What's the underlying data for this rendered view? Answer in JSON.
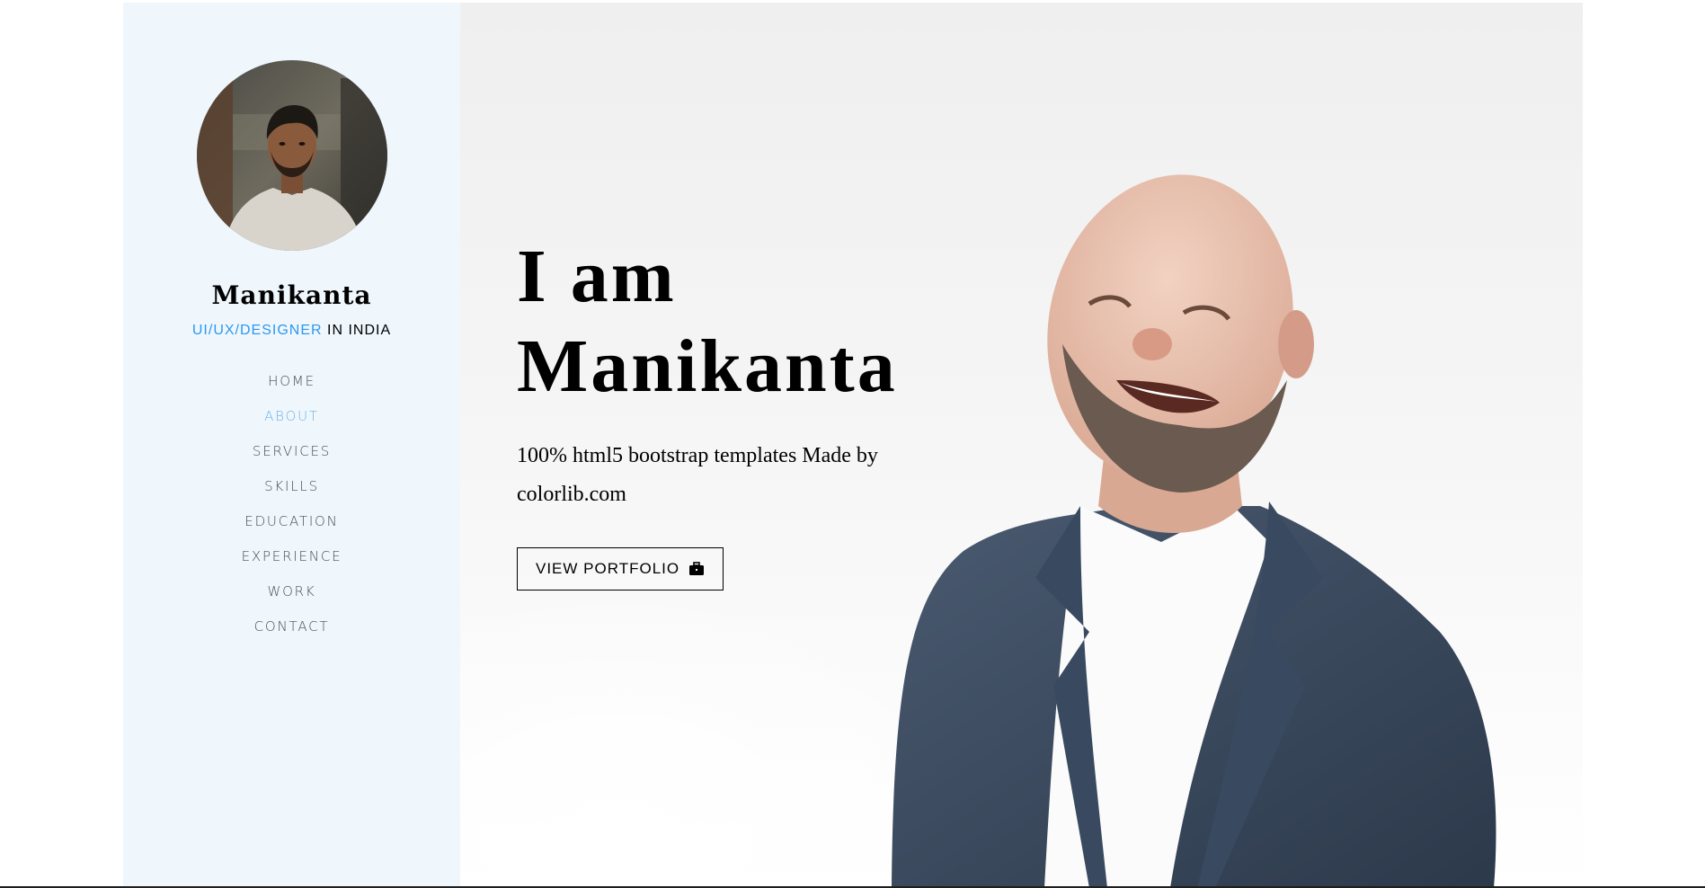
{
  "profile": {
    "name": "Manikanta",
    "role_accent": "UI/UX/DESIGNER",
    "role_rest": " IN INDIA"
  },
  "nav": {
    "items": [
      {
        "label": "HOME"
      },
      {
        "label": "ABOUT"
      },
      {
        "label": "SERVICES"
      },
      {
        "label": "SKILLS"
      },
      {
        "label": "EDUCATION"
      },
      {
        "label": "EXPERIENCE"
      },
      {
        "label": "WORK"
      },
      {
        "label": "CONTACT"
      }
    ],
    "active": "ABOUT"
  },
  "hero": {
    "title_line1": "I am",
    "title_line2": "Manikanta",
    "subtitle": "100% html5 bootstrap templates Made by colorlib.com",
    "button_label": "VIEW PORTFOLIO",
    "button_icon": "briefcase-icon"
  },
  "colors": {
    "sidebar_bg": "#eff7fd",
    "accent": "#2c98f0",
    "nav_active": "#6db2ea"
  }
}
